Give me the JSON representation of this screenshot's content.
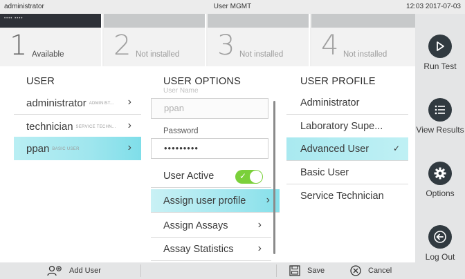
{
  "statusbar": {
    "user": "administrator",
    "title": "User MGMT",
    "clock": "12:03 2017-07-03"
  },
  "modules": [
    {
      "number": "1",
      "state": "Available",
      "tag": "•••• ••••"
    },
    {
      "number": "2",
      "state": "Not installed"
    },
    {
      "number": "3",
      "state": "Not installed"
    },
    {
      "number": "4",
      "state": "Not installed"
    }
  ],
  "sidebar": {
    "run_test": "Run Test",
    "view_results": "View Results",
    "options": "Options",
    "log_out": "Log Out"
  },
  "user_column": {
    "header": "USER",
    "users": [
      {
        "name": "administrator",
        "role": "ADMINIST..."
      },
      {
        "name": "technician",
        "role": "SERVICE TECHN..."
      },
      {
        "name": "ppan",
        "role": "BASIC USER"
      }
    ]
  },
  "options_column": {
    "header": "USER OPTIONS",
    "username_label": "User Name",
    "username_value": "ppan",
    "password_label": "Password",
    "password_value": "•••••••••",
    "user_active_label": "User Active",
    "assign_profile": "Assign user profile",
    "assign_assays": "Assign Assays",
    "assay_statistics": "Assay Statistics"
  },
  "profile_column": {
    "header": "USER PROFILE",
    "profiles": [
      {
        "label": "Administrator"
      },
      {
        "label": "Laboratory Supe..."
      },
      {
        "label": "Advanced User"
      },
      {
        "label": "Basic User"
      },
      {
        "label": "Service Technician"
      }
    ]
  },
  "bottombar": {
    "add_user": "Add User",
    "save": "Save",
    "cancel": "Cancel"
  },
  "colors": {
    "accent_cyan": "#9fe6ee",
    "toggle_green": "#7ad03a",
    "dark_button": "#313a40"
  }
}
